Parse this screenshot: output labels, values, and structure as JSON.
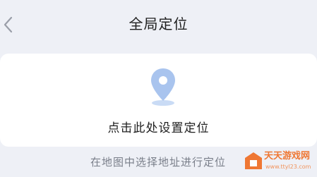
{
  "nav": {
    "title": "全局定位",
    "back_icon": "chevron-left-icon"
  },
  "card": {
    "icon": "map-pin-icon",
    "label": "点击此处设置定位"
  },
  "map_link": {
    "label": "在地图中选择地址进行定位"
  },
  "watermark": {
    "title": "天天游戏网",
    "url": "www.ttyl23.com"
  },
  "colors": {
    "page_background": "#eef0f6",
    "card_background": "#ffffff",
    "pin_color": "#a9c4ee",
    "watermark_orange": "#f06a1e"
  }
}
